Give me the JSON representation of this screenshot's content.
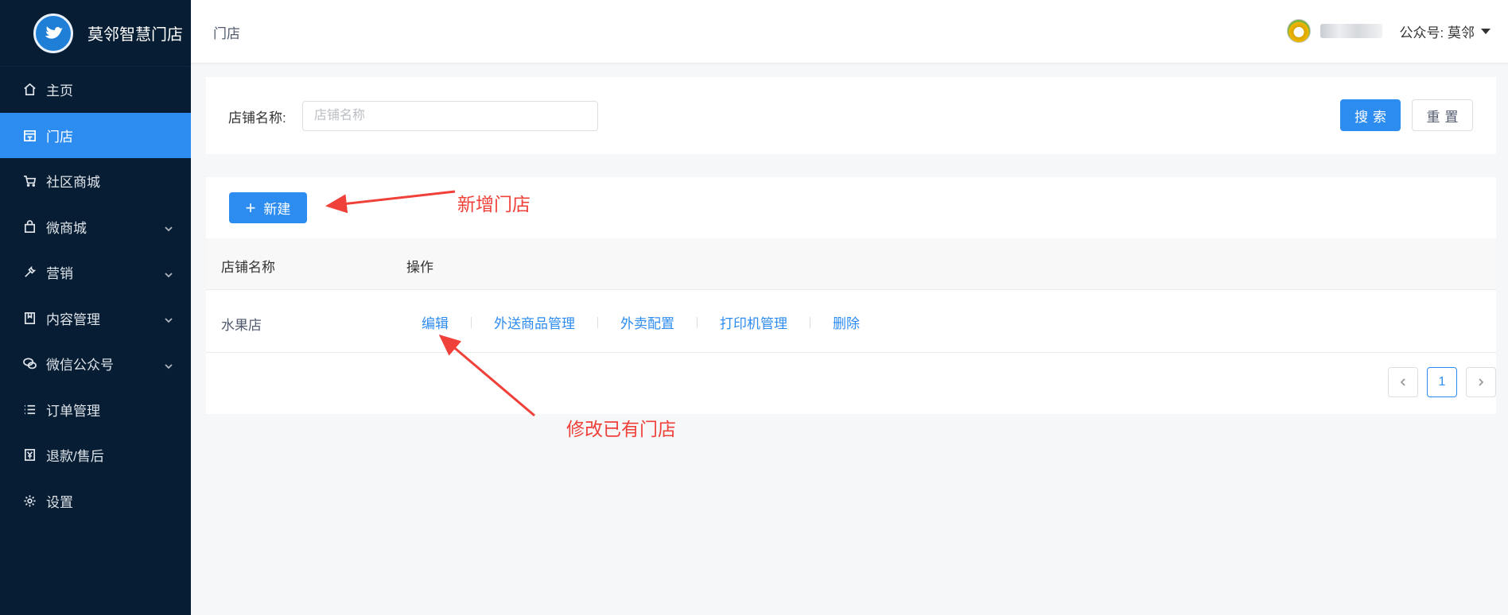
{
  "app": {
    "brand_title": "莫邻智慧门店"
  },
  "sidebar": {
    "items": [
      {
        "label": "主页",
        "icon": "home-icon"
      },
      {
        "label": "门店",
        "icon": "store-icon",
        "active": true
      },
      {
        "label": "社区商城",
        "icon": "cart-icon"
      },
      {
        "label": "微商城",
        "icon": "bag-icon",
        "expandable": true
      },
      {
        "label": "营销",
        "icon": "wrench-icon",
        "expandable": true
      },
      {
        "label": "内容管理",
        "icon": "document-icon",
        "expandable": true
      },
      {
        "label": "微信公众号",
        "icon": "wechat-icon",
        "expandable": true
      },
      {
        "label": "订单管理",
        "icon": "list-icon"
      },
      {
        "label": "退款/售后",
        "icon": "refund-icon"
      },
      {
        "label": "设置",
        "icon": "gear-icon"
      }
    ]
  },
  "header": {
    "breadcrumb": "门店",
    "account_label": "公众号: 莫邻"
  },
  "search": {
    "label": "店铺名称:",
    "placeholder": "店铺名称",
    "value": "",
    "search_button": "搜索",
    "reset_button": "重置"
  },
  "toolbar": {
    "new_button": "新建"
  },
  "table": {
    "columns": [
      "店铺名称",
      "操作"
    ],
    "rows": [
      {
        "name": "水果店",
        "actions": [
          "编辑",
          "外送商品管理",
          "外卖配置",
          "打印机管理",
          "删除"
        ]
      }
    ]
  },
  "pagination": {
    "current_page": "1"
  },
  "annotations": {
    "new_store": "新增门店",
    "edit_store": "修改已有门店",
    "color": "#f0403a"
  },
  "colors": {
    "accent": "#2d8cf0",
    "sidebar_bg": "#071d33"
  }
}
